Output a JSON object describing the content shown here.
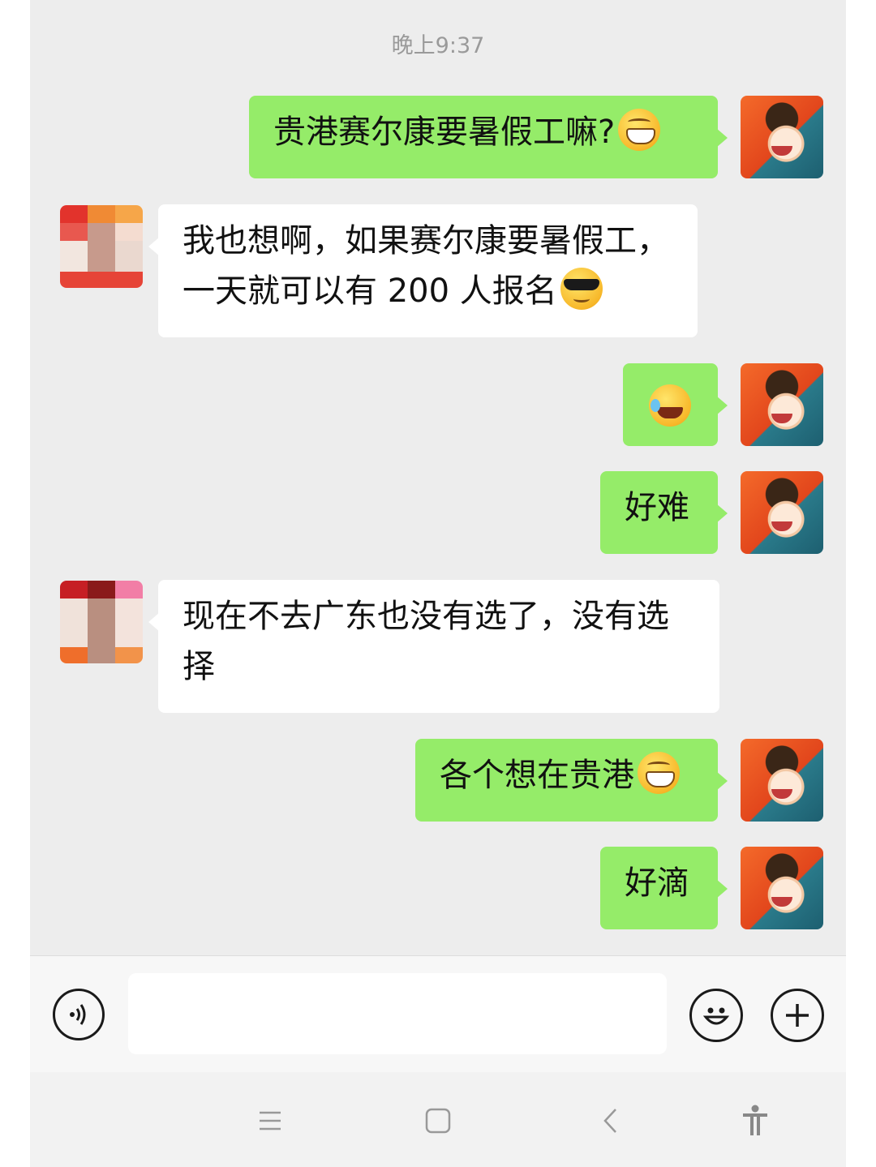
{
  "chat": {
    "timestamp": "晚上9:37",
    "messages": [
      {
        "side": "right",
        "text": "贵港赛尔康要暑假工嘛?",
        "emoji": "grin-emoji"
      },
      {
        "side": "left",
        "line1": "我也想啊，如果赛尔康要暑假工，",
        "line2": "一天就可以有 200 人报名",
        "emoji": "sunglasses-emoji"
      },
      {
        "side": "right",
        "text": "",
        "emoji": "rolling-laughing-emoji"
      },
      {
        "side": "right",
        "text": "好难"
      },
      {
        "side": "left",
        "line1": "现在不去广东也没有选了，没有选",
        "line2": "择"
      },
      {
        "side": "right",
        "text": "各个想在贵港",
        "emoji": "grin-emoji"
      },
      {
        "side": "right",
        "text": "好滴"
      }
    ]
  },
  "input_bar": {
    "voice_icon": "voice-icon",
    "text_value": "",
    "emoji_icon": "smiley-icon",
    "more_icon": "plus-icon"
  },
  "nav_bar": {
    "icons": [
      "menu-icon",
      "home-square-icon",
      "back-icon",
      "accessibility-icon"
    ]
  },
  "colors": {
    "chat_background": "#ededed",
    "sent_bubble": "#95ec69",
    "received_bubble": "#ffffff"
  }
}
